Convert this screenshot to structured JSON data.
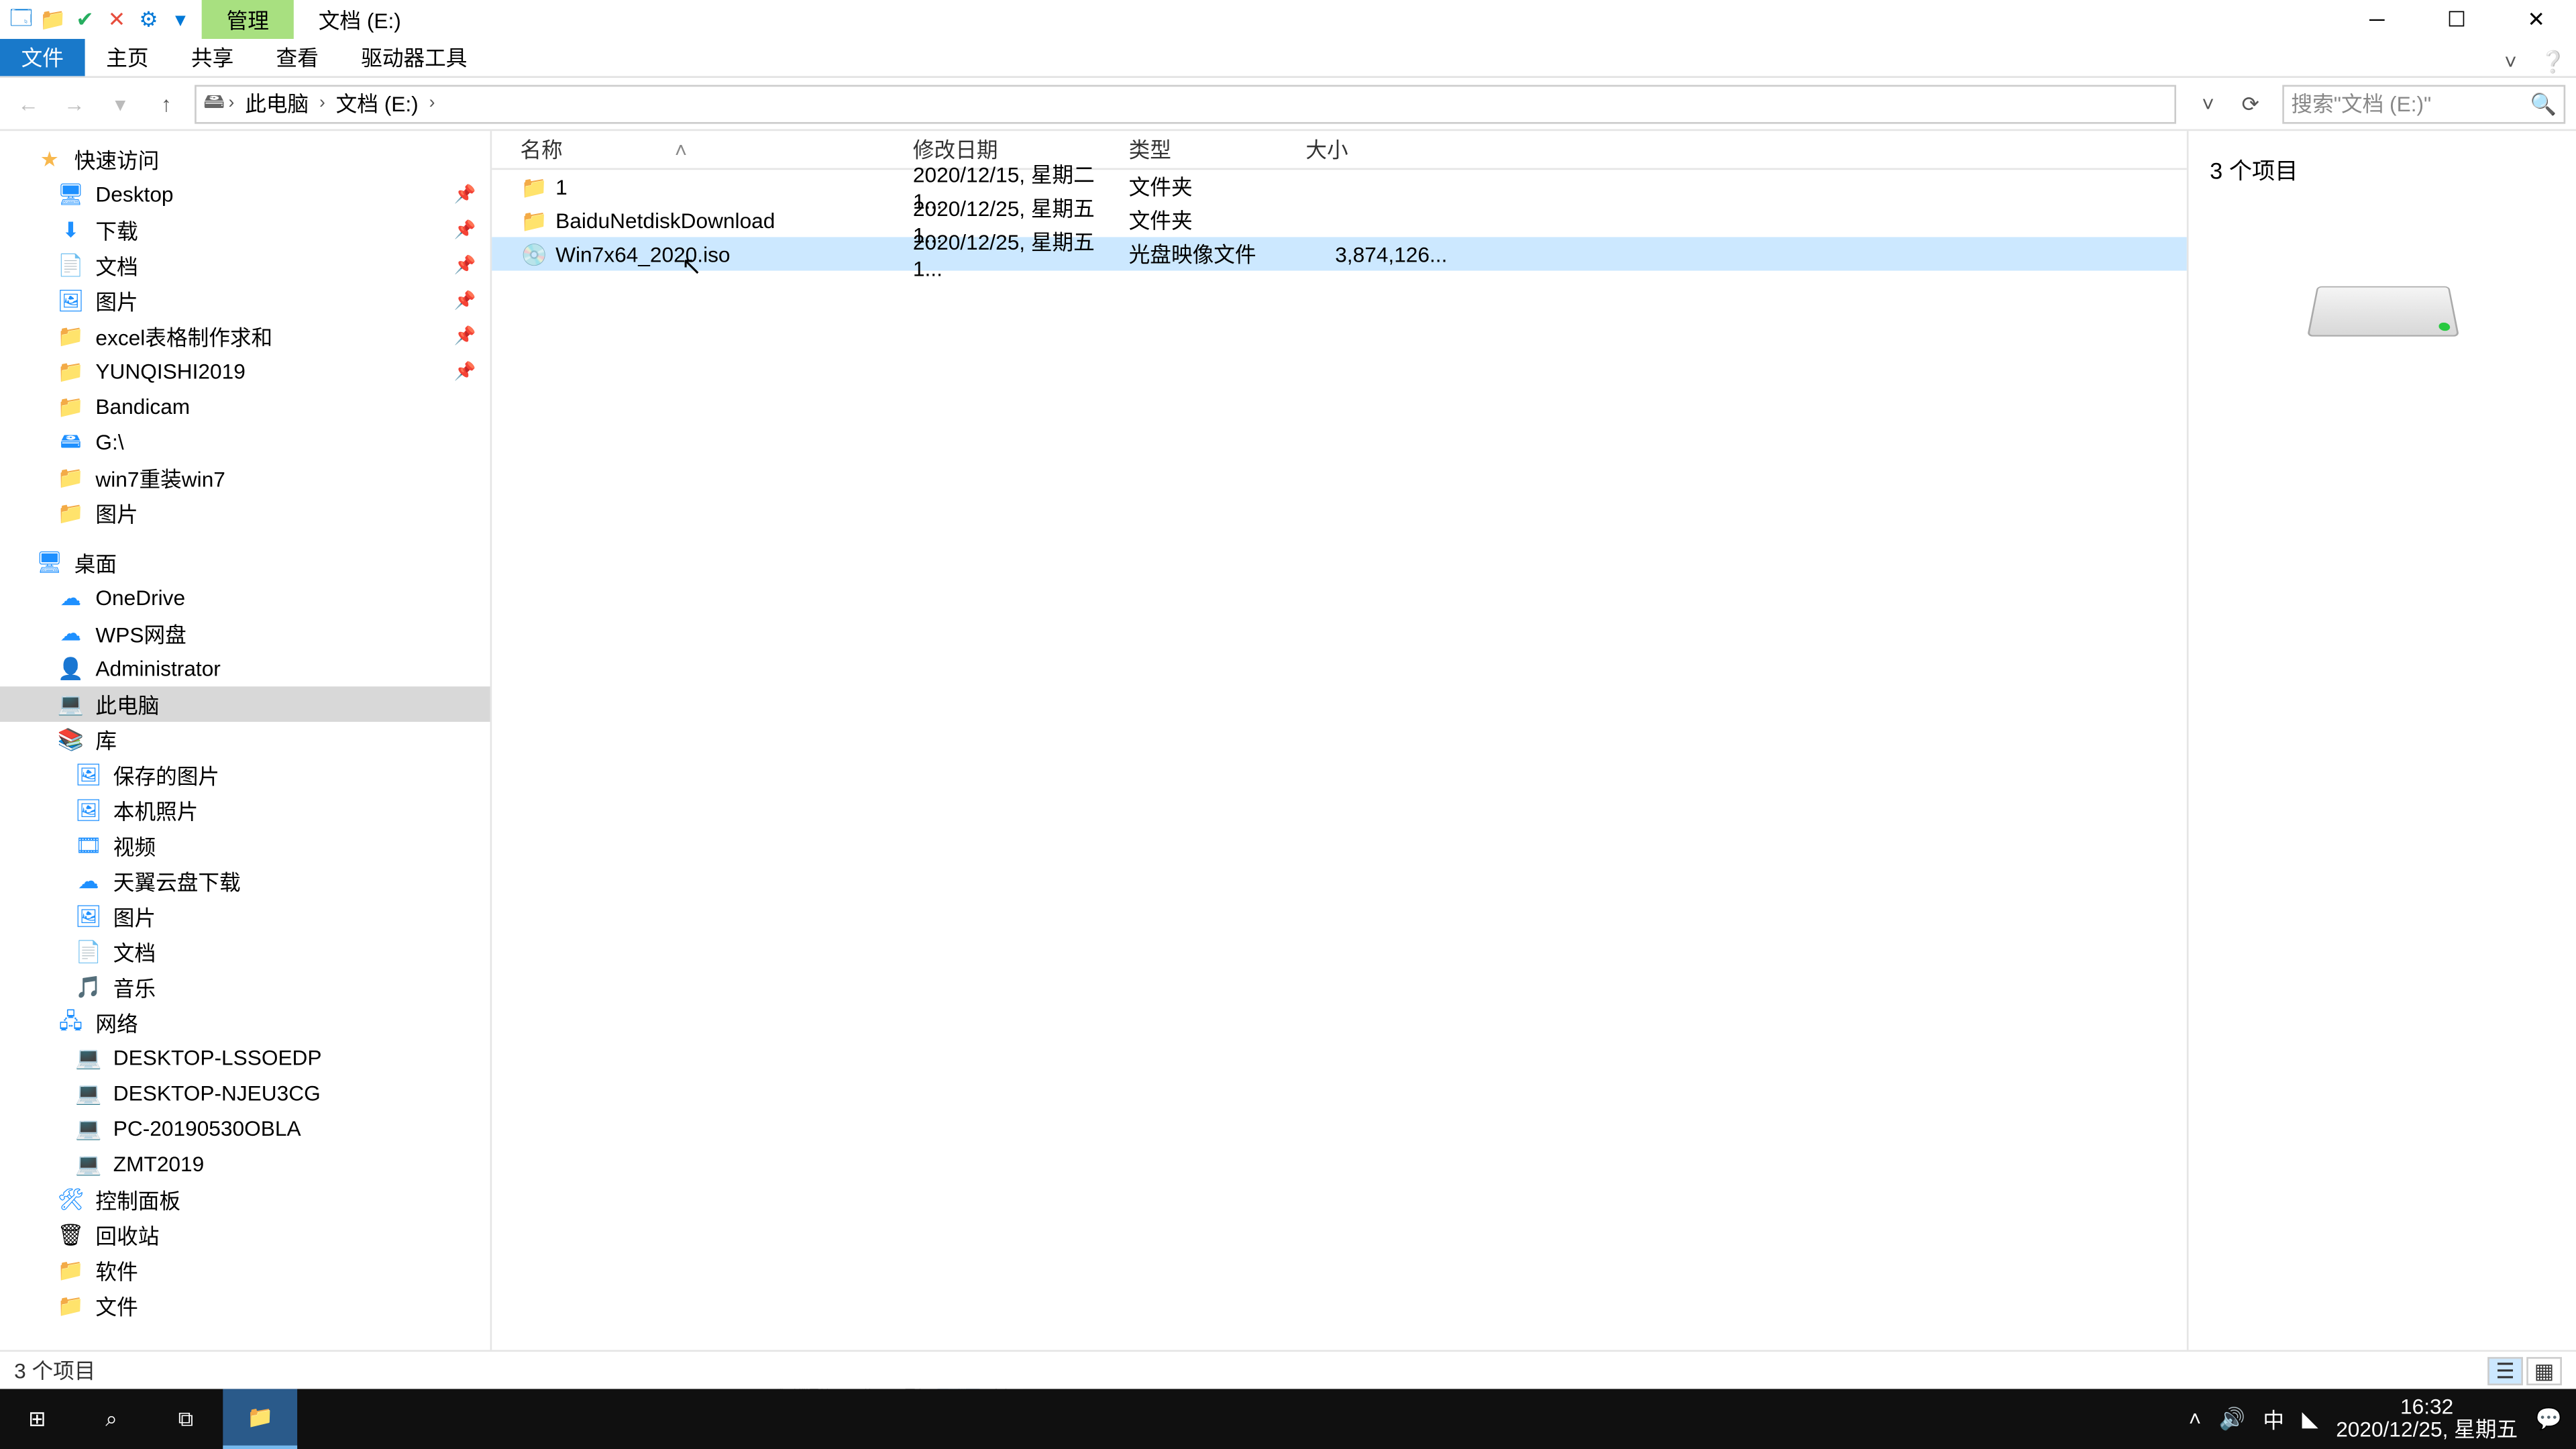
{
  "titlebar": {
    "manage": "管理",
    "title": "文档 (E:)"
  },
  "ribbon": {
    "file": "文件",
    "home": "主页",
    "share": "共享",
    "view": "查看",
    "drivetools": "驱动器工具"
  },
  "breadcrumb": {
    "seg1": "此电脑",
    "seg2": "文档 (E:)"
  },
  "search": {
    "placeholder": "搜索\"文档 (E:)\""
  },
  "nav": {
    "quickaccess": "快速访问",
    "desktop": "Desktop",
    "downloads": "下载",
    "documents": "文档",
    "pictures": "图片",
    "excel": "excel表格制作求和",
    "yunqishi": "YUNQISHI2019",
    "bandicam": "Bandicam",
    "gdrive": "G:\\",
    "win7reinstall": "win7重装win7",
    "pictures2": "图片",
    "desktoproot": "桌面",
    "onedrive": "OneDrive",
    "wps": "WPS网盘",
    "admin": "Administrator",
    "thispc": "此电脑",
    "libraries": "库",
    "savedpics": "保存的图片",
    "cameraroll": "本机照片",
    "videos": "视频",
    "tianyi": "天翼云盘下载",
    "libpics": "图片",
    "libdocs": "文档",
    "libmusic": "音乐",
    "network": "网络",
    "net1": "DESKTOP-LSSOEDP",
    "net2": "DESKTOP-NJEU3CG",
    "net3": "PC-20190530OBLA",
    "net4": "ZMT2019",
    "controlpanel": "控制面板",
    "recycle": "回收站",
    "software": "软件",
    "files": "文件"
  },
  "columns": {
    "name": "名称",
    "date": "修改日期",
    "type": "类型",
    "size": "大小"
  },
  "files": [
    {
      "name": "1",
      "date": "2020/12/15, 星期二 1...",
      "type": "文件夹",
      "size": ""
    },
    {
      "name": "BaiduNetdiskDownload",
      "date": "2020/12/25, 星期五 1...",
      "type": "文件夹",
      "size": ""
    },
    {
      "name": "Win7x64_2020.iso",
      "date": "2020/12/25, 星期五 1...",
      "type": "光盘映像文件",
      "size": "3,874,126..."
    }
  ],
  "preview": {
    "count": "3 个项目"
  },
  "status": {
    "text": "3 个项目"
  },
  "tray": {
    "ime": "中",
    "time": "16:32",
    "date": "2020/12/25, 星期五"
  }
}
